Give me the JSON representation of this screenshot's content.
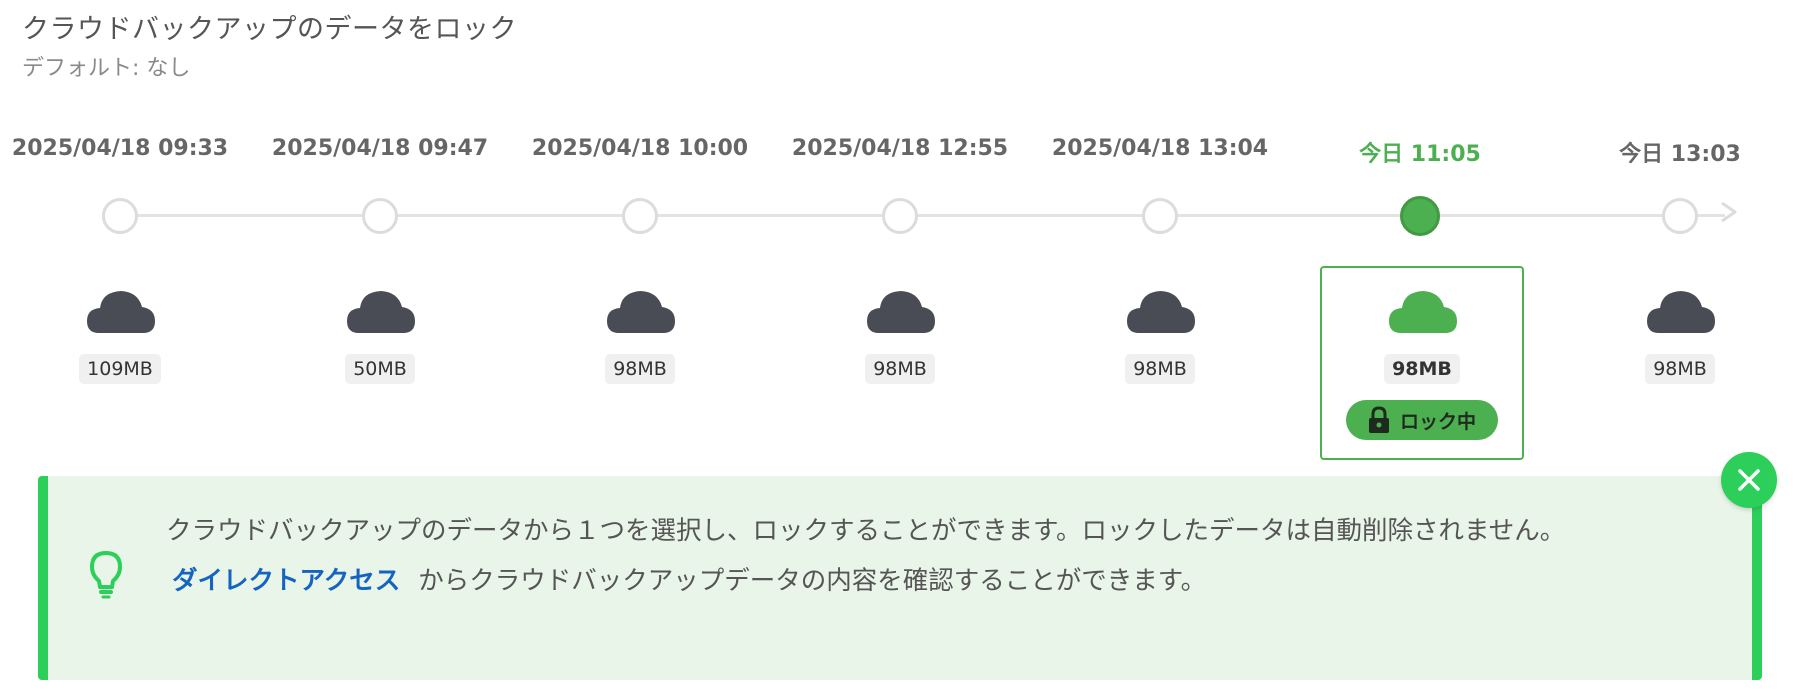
{
  "header": {
    "title": "クラウドバックアップのデータをロック",
    "subtitle": "デフォルト: なし"
  },
  "timeline": {
    "snapshots": [
      {
        "date": "2025/04/18 09:33",
        "size": "109MB",
        "selected": false
      },
      {
        "date": "2025/04/18 09:47",
        "size": "50MB",
        "selected": false
      },
      {
        "date": "2025/04/18 10:00",
        "size": "98MB",
        "selected": false
      },
      {
        "date": "2025/04/18 12:55",
        "size": "98MB",
        "selected": false
      },
      {
        "date": "2025/04/18 13:04",
        "size": "98MB",
        "selected": false
      },
      {
        "date": "今日 11:05",
        "size": "98MB",
        "selected": true
      },
      {
        "date": "今日 13:03",
        "size": "98MB",
        "selected": false
      }
    ],
    "lock_badge": "ロック中",
    "colors": {
      "active": "#4caf50",
      "cloud": "#4a4c55"
    }
  },
  "info": {
    "line1": "クラウドバックアップのデータから１つを選択し、ロックすることができます。ロックしたデータは自動削除されません。",
    "link": "ダイレクトアクセス",
    "line2_rest": "からクラウドバックアップデータの内容を確認することができます。",
    "bulb_icon": "lightbulb-icon",
    "close_icon": "close-icon"
  }
}
